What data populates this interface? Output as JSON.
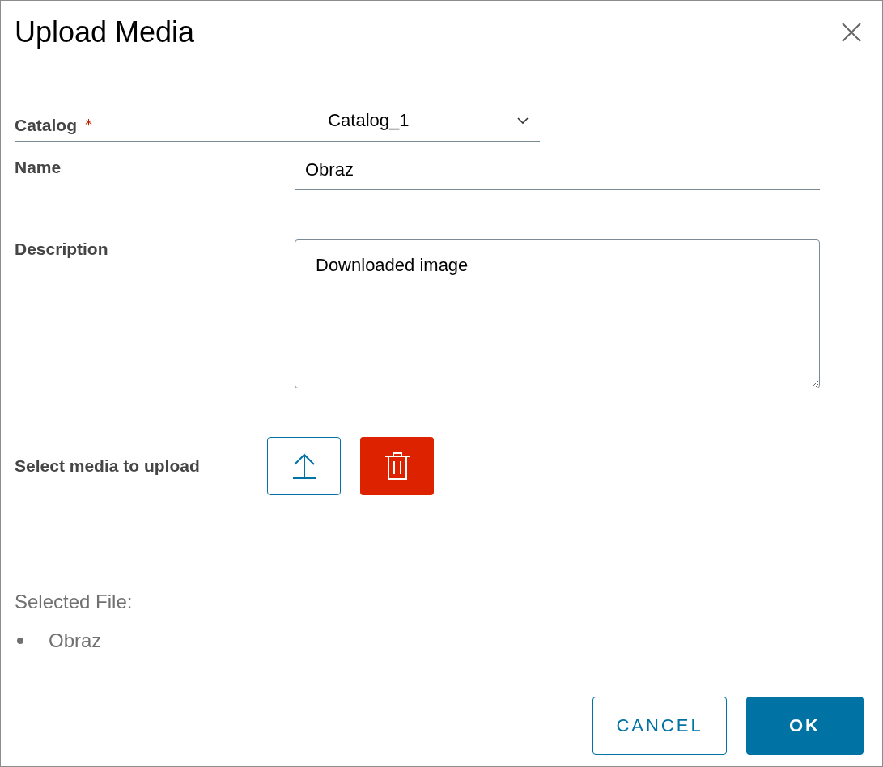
{
  "dialog": {
    "title": "Upload Media"
  },
  "fields": [
    {
      "kind": "select",
      "label": "Catalog",
      "required_mark": "*",
      "value": "Catalog_1"
    },
    {
      "kind": "text",
      "label": "Name",
      "value": "Obraz"
    },
    {
      "kind": "textarea",
      "label": "Description",
      "value": "Downloaded image"
    }
  ],
  "upload": {
    "label": "Select media to upload"
  },
  "selected_file": {
    "label": "Selected File:",
    "files": [
      "Obraz"
    ]
  },
  "buttons": [
    {
      "kind": "secondary",
      "label": "CANCEL"
    },
    {
      "kind": "primary",
      "label": "OK"
    }
  ]
}
